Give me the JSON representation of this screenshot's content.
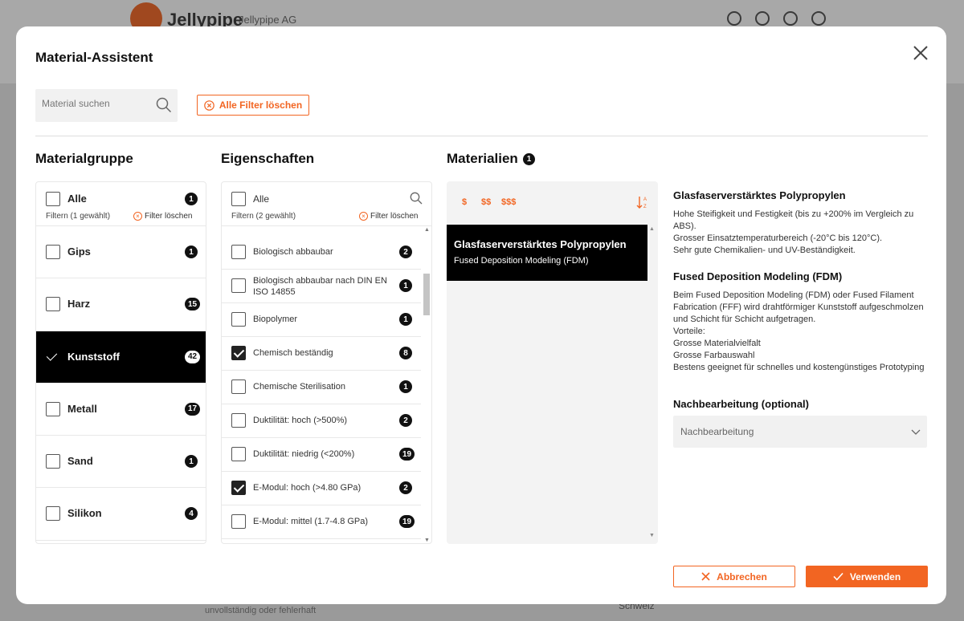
{
  "background": {
    "logo_text": "Jellypipe",
    "logo_sub": "Jellypipe AG",
    "footer_text_1": "unvollständig oder fehlerhaft",
    "footer_text_2": "Schweiz"
  },
  "modal": {
    "title": "Material-Assistent",
    "search_placeholder": "Material suchen",
    "clear_all_label": "Alle Filter löschen"
  },
  "materialgruppe": {
    "title": "Materialgruppe",
    "all_label": "Alle",
    "all_count": "1",
    "filter_note": "Filtern (1 gewählt)",
    "filter_clear": "Filter löschen",
    "items": [
      {
        "label": "Gips",
        "count": "1",
        "active": false
      },
      {
        "label": "Harz",
        "count": "15",
        "active": false
      },
      {
        "label": "Kunststoff",
        "count": "42",
        "active": true
      },
      {
        "label": "Metall",
        "count": "17",
        "active": false
      },
      {
        "label": "Sand",
        "count": "1",
        "active": false
      },
      {
        "label": "Silikon",
        "count": "4",
        "active": false
      }
    ]
  },
  "eigenschaften": {
    "title": "Eigenschaften",
    "all_label": "Alle",
    "filter_note": "Filtern (2 gewählt)",
    "filter_clear": "Filter löschen",
    "items": [
      {
        "label": "Biologisch abbaubar",
        "count": "2",
        "checked": false
      },
      {
        "label": "Biologisch abbaubar nach DIN EN ISO 14855",
        "count": "1",
        "checked": false
      },
      {
        "label": "Biopolymer",
        "count": "1",
        "checked": false
      },
      {
        "label": "Chemisch beständig",
        "count": "8",
        "checked": true
      },
      {
        "label": "Chemische Sterilisation",
        "count": "1",
        "checked": false
      },
      {
        "label": "Duktilität: hoch (>500%)",
        "count": "2",
        "checked": false
      },
      {
        "label": "Duktilität: niedrig (<200%)",
        "count": "19",
        "checked": false
      },
      {
        "label": "E-Modul: hoch (>4.80 GPa)",
        "count": "2",
        "checked": true
      },
      {
        "label": "E-Modul: mittel (1.7-4.8 GPa)",
        "count": "19",
        "checked": false
      }
    ]
  },
  "materialien": {
    "title": "Materialien",
    "count": "1",
    "price_1": "$",
    "price_2": "$$",
    "price_3": "$$$",
    "card_title": "Glasfaserverstärktes Polypropylen",
    "card_sub": "Fused Deposition Modeling (FDM)"
  },
  "details": {
    "material_title": "Glasfaserverstärktes Polypropylen",
    "material_text": "Hohe Steifigkeit und Festigkeit (bis zu +200% im Vergleich zu ABS).\nGrosser Einsatztemperaturbereich (-20°C bis 120°C).\nSehr gute Chemikalien- und UV-Beständigkeit.",
    "process_title": "Fused Deposition Modeling (FDM)",
    "process_text": "Beim Fused Deposition Modeling (FDM) oder Fused Filament Fabrication (FFF) wird drahtförmiger Kunststoff aufgeschmolzen und Schicht für Schicht aufgetragen.\nVorteile:\nGrosse Materialvielfalt\nGrosse Farbauswahl\nBestens geeignet für schnelles und kostengünstiges Prototyping",
    "post_title": "Nachbearbeitung (optional)",
    "post_placeholder": "Nachbearbeitung"
  },
  "buttons": {
    "cancel": "Abbrechen",
    "apply": "Verwenden"
  },
  "colors": {
    "accent": "#f26522",
    "active_bg": "#000000"
  }
}
